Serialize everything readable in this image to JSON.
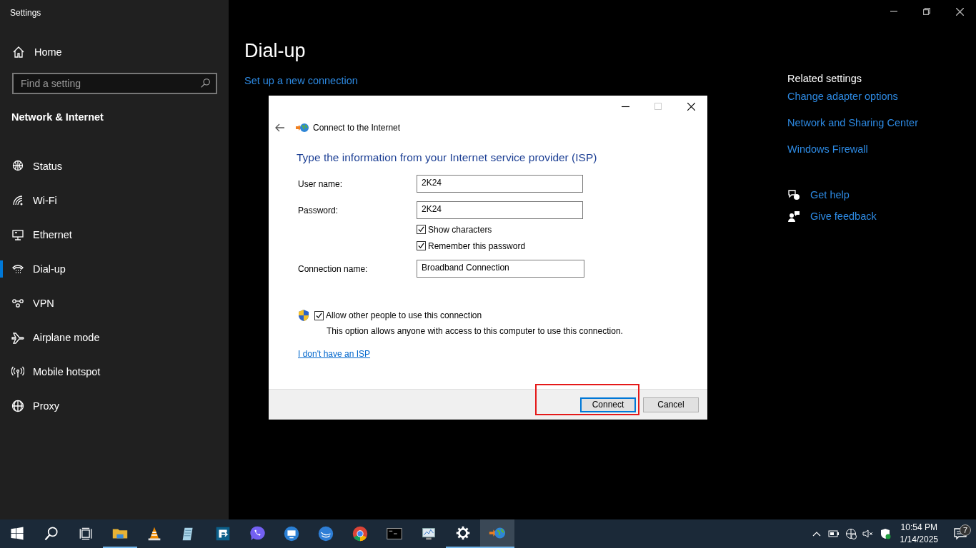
{
  "window": {
    "title": "Settings"
  },
  "sidebar": {
    "home": "Home",
    "search": {
      "placeholder": "Find a setting"
    },
    "section": "Network & Internet",
    "items": [
      {
        "label": "Status",
        "selected": false
      },
      {
        "label": "Wi-Fi",
        "selected": false
      },
      {
        "label": "Ethernet",
        "selected": false
      },
      {
        "label": "Dial-up",
        "selected": true
      },
      {
        "label": "VPN",
        "selected": false
      },
      {
        "label": "Airplane mode",
        "selected": false
      },
      {
        "label": "Mobile hotspot",
        "selected": false
      },
      {
        "label": "Proxy",
        "selected": false
      }
    ]
  },
  "page": {
    "title": "Dial-up",
    "link": "Set up a new connection"
  },
  "related": {
    "heading": "Related settings",
    "links": [
      "Change adapter options",
      "Network and Sharing Center",
      "Windows Firewall"
    ],
    "help": [
      "Get help",
      "Give feedback"
    ]
  },
  "dialog": {
    "title": "Connect to the Internet",
    "heading": "Type the information from your Internet service provider (ISP)",
    "fields": [
      {
        "label": "User name:",
        "value": "2K24"
      },
      {
        "label": "Password:",
        "value": "2K24"
      }
    ],
    "checkboxes": [
      {
        "label": "Show characters",
        "checked": true
      },
      {
        "label": "Remember this password",
        "checked": true
      }
    ],
    "connection_name": {
      "label": "Connection name:",
      "value": "Broadband Connection"
    },
    "allow": {
      "label": "Allow other people to use this connection",
      "checked": true,
      "note": "This option allows anyone with access to this computer to use this connection."
    },
    "link": "I don't have an ISP",
    "buttons": [
      {
        "label": "Connect",
        "default": true
      },
      {
        "label": "Cancel",
        "default": false
      }
    ]
  },
  "taskbar": {
    "apps": [
      {
        "running": true,
        "selected": false
      },
      {
        "running": false,
        "selected": false
      },
      {
        "running": false,
        "selected": false
      },
      {
        "running": false,
        "selected": false
      },
      {
        "running": false,
        "selected": false
      },
      {
        "running": false,
        "selected": false
      },
      {
        "running": false,
        "selected": false
      },
      {
        "running": false,
        "selected": false
      },
      {
        "running": false,
        "selected": false
      },
      {
        "running": false,
        "selected": false
      },
      {
        "running": true,
        "selected": false
      },
      {
        "running": true,
        "selected": true
      }
    ],
    "clock": {
      "time": "10:54 PM",
      "date": "1/14/2025"
    },
    "notifications": "7"
  }
}
